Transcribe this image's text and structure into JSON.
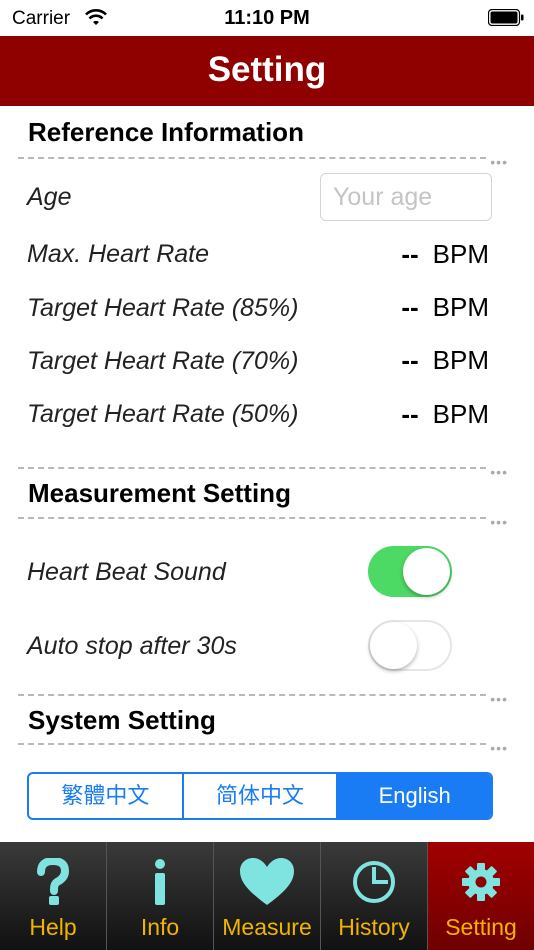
{
  "status_bar": {
    "carrier": "Carrier",
    "time": "11:10 PM"
  },
  "nav": {
    "title": "Setting"
  },
  "reference": {
    "title": "Reference Information",
    "age_label": "Age",
    "age_value": "",
    "age_placeholder": "Your age",
    "rows": [
      {
        "label": "Max. Heart Rate",
        "value": "--",
        "unit": "BPM"
      },
      {
        "label": "Target Heart Rate (85%)",
        "value": "--",
        "unit": "BPM"
      },
      {
        "label": "Target Heart Rate (70%)",
        "value": "--",
        "unit": "BPM"
      },
      {
        "label": "Target Heart Rate (50%)",
        "value": "--",
        "unit": "BPM"
      }
    ]
  },
  "measurement": {
    "title": "Measurement Setting",
    "heart_beat_sound": {
      "label": "Heart Beat Sound",
      "on": true
    },
    "auto_stop": {
      "label": "Auto stop after 30s",
      "on": false
    }
  },
  "system": {
    "title": "System Setting",
    "languages": [
      "繁體中文",
      "简体中文",
      "English"
    ],
    "selected_language": "English"
  },
  "tabs": [
    {
      "label": "Help",
      "icon": "question-icon"
    },
    {
      "label": "Info",
      "icon": "info-icon"
    },
    {
      "label": "Measure",
      "icon": "heart-icon"
    },
    {
      "label": "History",
      "icon": "pie-chart-icon"
    },
    {
      "label": "Setting",
      "icon": "gear-icon",
      "active": true
    }
  ],
  "colors": {
    "nav_background": "#8f0000",
    "toggle_on": "#4cd964",
    "segment_accent": "#1a7cf5",
    "tab_label": "#f0b400",
    "tab_icon": "#7fe3e0",
    "active_tab_background": "#8f0000"
  }
}
